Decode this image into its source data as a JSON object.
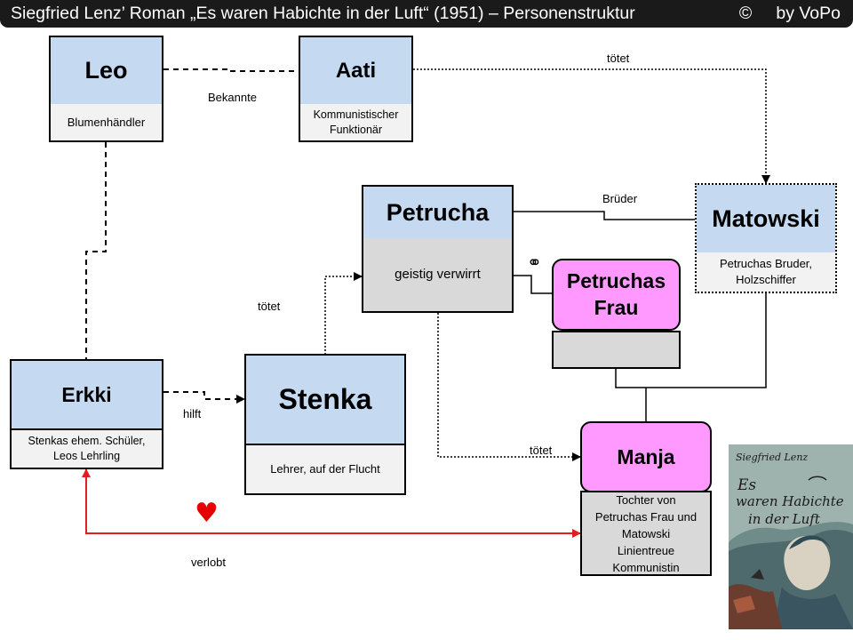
{
  "title": {
    "main": "Siegfried Lenz’ Roman „Es waren Habichte in der Luft“ (1951) – Personenstruktur",
    "copyright": "©",
    "author": "by VoPo"
  },
  "persons": {
    "leo": {
      "name": "Leo",
      "desc": "Blumenhändler"
    },
    "aati": {
      "name": "Aati",
      "desc_line1": "Kommunistischer",
      "desc_line2": "Funktionär"
    },
    "petrucha": {
      "name": "Petrucha",
      "desc": "geistig verwirrt"
    },
    "matowski": {
      "name": "Matowski",
      "desc_line1": "Petruchas Bruder,",
      "desc_line2": "Holzschiffer"
    },
    "petruchas_frau": {
      "name_line1": "Petruchas",
      "name_line2": "Frau"
    },
    "erkki": {
      "name": "Erkki",
      "desc_line1": "Stenkas ehem. Schüler,",
      "desc_line2": "Leos Lehrling"
    },
    "stenka": {
      "name": "Stenka",
      "desc": "Lehrer, auf der Flucht"
    },
    "manja": {
      "name": "Manja",
      "desc_lines": [
        "Tochter von",
        "Petruchas Frau und",
        "Matowski",
        "Linientreue",
        "Kommunistin"
      ]
    }
  },
  "relations": {
    "bekannte": "Bekannte",
    "aati_kills_matowski": "tötet",
    "brueder": "Brüder",
    "marriage_symbol": "⚭",
    "stenka_kills_petrucha": "tötet",
    "hilft": "hilft",
    "petrucha_kills_manja": "tötet",
    "verlobt": "verlobt",
    "heart": "♥"
  },
  "cover": {
    "author": "Siegfried Lenz",
    "title_line1": "Es",
    "title_line2": "waren Habichte",
    "title_line3": "in der Luft"
  },
  "colors": {
    "blue": "#c5d9f1",
    "pink": "#ff99ff",
    "red": "#e02020"
  }
}
